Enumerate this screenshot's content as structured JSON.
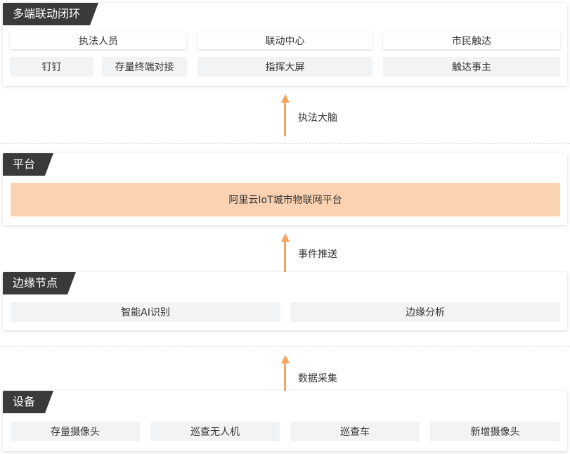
{
  "layers": {
    "closed_loop": {
      "title": "多端联动闭环",
      "headers": [
        "执法人员",
        "联动中心",
        "市民触达"
      ],
      "items": [
        "钉钉",
        "存量终端对接",
        "指挥大屏",
        "触达事主"
      ]
    },
    "platform": {
      "title": "平台",
      "main": "阿里云IoT城市物联网平台"
    },
    "edge": {
      "title": "边缘节点",
      "items": [
        "智能AI识别",
        "边缘分析"
      ]
    },
    "devices": {
      "title": "设备",
      "items": [
        "存量摄像头",
        "巡查无人机",
        "巡查车",
        "新增摄像头"
      ]
    }
  },
  "arrows": [
    "执法大脑",
    "事件推送",
    "数据采集"
  ],
  "colors": {
    "tag_bg": "#3a3a3a",
    "arrow": "#f7a560",
    "platform_box": "#fcd3b2",
    "box_bg": "#f2f3f5"
  }
}
